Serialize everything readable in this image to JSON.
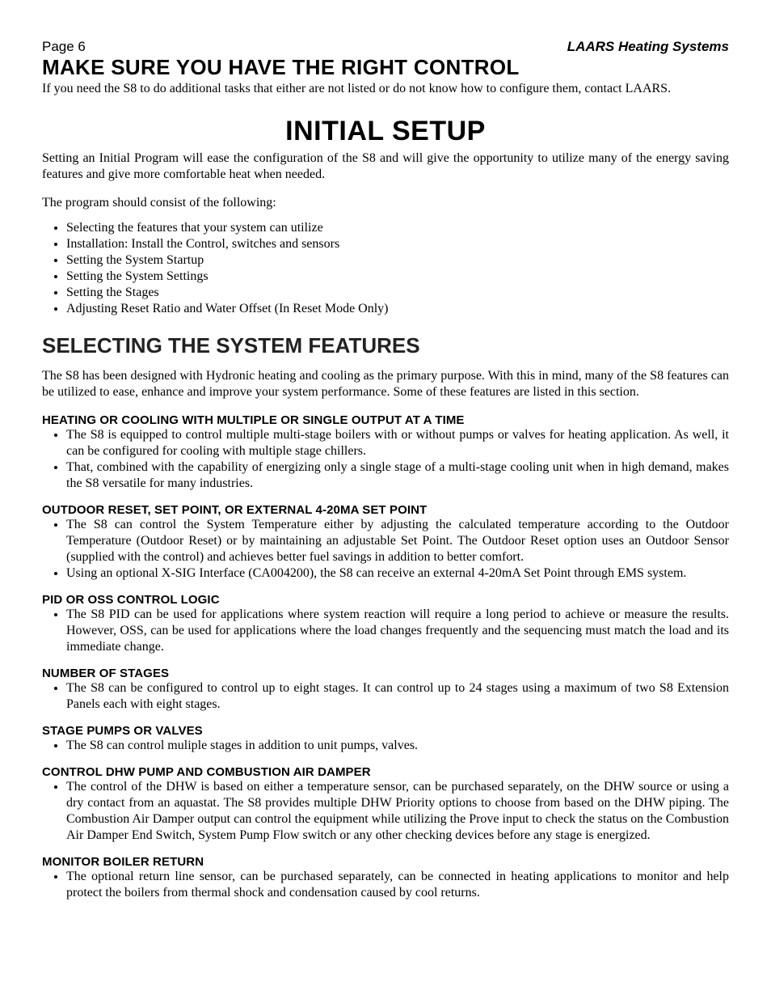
{
  "header": {
    "pageLabel": "Page 6",
    "brand": "LAARS Heating Systems"
  },
  "topTitle": "MAKE SURE YOU HAVE THE RIGHT CONTROL",
  "topSub": "If you need the S8 to do additional tasks that either are not listed or do not know how to configure them, contact LAARS.",
  "initial": {
    "title": "INITIAL SETUP",
    "p1": "Setting an Initial Program will ease the configuration of the S8 and will give the opportunity to utilize many of the energy saving features and give more comfortable heat when needed.",
    "p2": "The program should consist of the following:",
    "items": [
      "Selecting the features that your system can utilize",
      "Installation: Install the Control, switches and sensors",
      "Setting the System Startup",
      "Setting the System Settings",
      "Setting the Stages",
      "Adjusting Reset Ratio and Water Offset (In Reset Mode Only)"
    ]
  },
  "features": {
    "title": "SELECTING THE SYSTEM FEATURES",
    "intro": "The S8 has been designed with Hydronic heating and cooling as the primary purpose.  With this in mind, many of the S8 features can be utilized to ease, enhance and improve your system performance.  Some of these features are listed in this section.",
    "sections": [
      {
        "heading": "HEATING OR COOLING WITH MULTIPLE OR SINGLE OUTPUT AT A TIME",
        "items": [
          "The S8 is equipped to control multiple multi-stage boilers with or without pumps or valves for heating application.  As well, it can be configured for cooling with multiple stage chillers.",
          "That, combined with the capability of energizing only a single stage of a multi-stage cooling unit when in high demand, makes the S8 versatile for many industries."
        ]
      },
      {
        "heading": "OUTDOOR RESET, SET POINT, OR EXTERNAL 4-20MA SET POINT",
        "items": [
          "The S8 can control the System Temperature either by adjusting the calculated temperature according to the Outdoor Temperature (Outdoor Reset) or by maintaining an adjustable Set Point.  The Outdoor Reset option uses an Outdoor Sensor (supplied with the control) and achieves better fuel savings in addition to better comfort.",
          "Using an optional X-SIG Interface (CA004200), the S8 can receive an external 4-20mA Set Point through EMS system."
        ]
      },
      {
        "heading": "PID OR OSS CONTROL LOGIC",
        "items": [
          "The S8 PID can be used for applications where system reaction will require a long period to achieve or measure the results.  However, OSS, can be used for applications where the load changes frequently and the sequencing must match the load and its immediate change."
        ]
      },
      {
        "heading": "NUMBER OF STAGES",
        "items": [
          "The S8 can be configured to control up to eight stages.  It can control up to 24 stages using a maximum of two S8 Extension Panels each with eight stages."
        ]
      },
      {
        "heading": "STAGE PUMPS OR VALVES",
        "items": [
          "The S8 can control muliple stages in addition to unit pumps, valves."
        ]
      },
      {
        "heading": "CONTROL DHW PUMP AND COMBUSTION AIR DAMPER",
        "items": [
          "The control of the DHW is based on either a temperature sensor, can be purchased separately, on the DHW source or using a dry contact from an aquastat.  The S8 provides multiple DHW Priority options to choose from based on the DHW piping.  The Combustion Air Damper output can control the equipment while utilizing the Prove input to check the status on the Combustion Air Damper End Switch, System Pump Flow switch or any other checking devices before any stage is energized."
        ]
      },
      {
        "heading": "MONITOR BOILER RETURN",
        "items": [
          "The optional return line sensor, can be purchased separately, can be connected in heating applications to monitor and help protect the boilers from thermal shock and condensation caused by cool returns."
        ]
      }
    ]
  }
}
